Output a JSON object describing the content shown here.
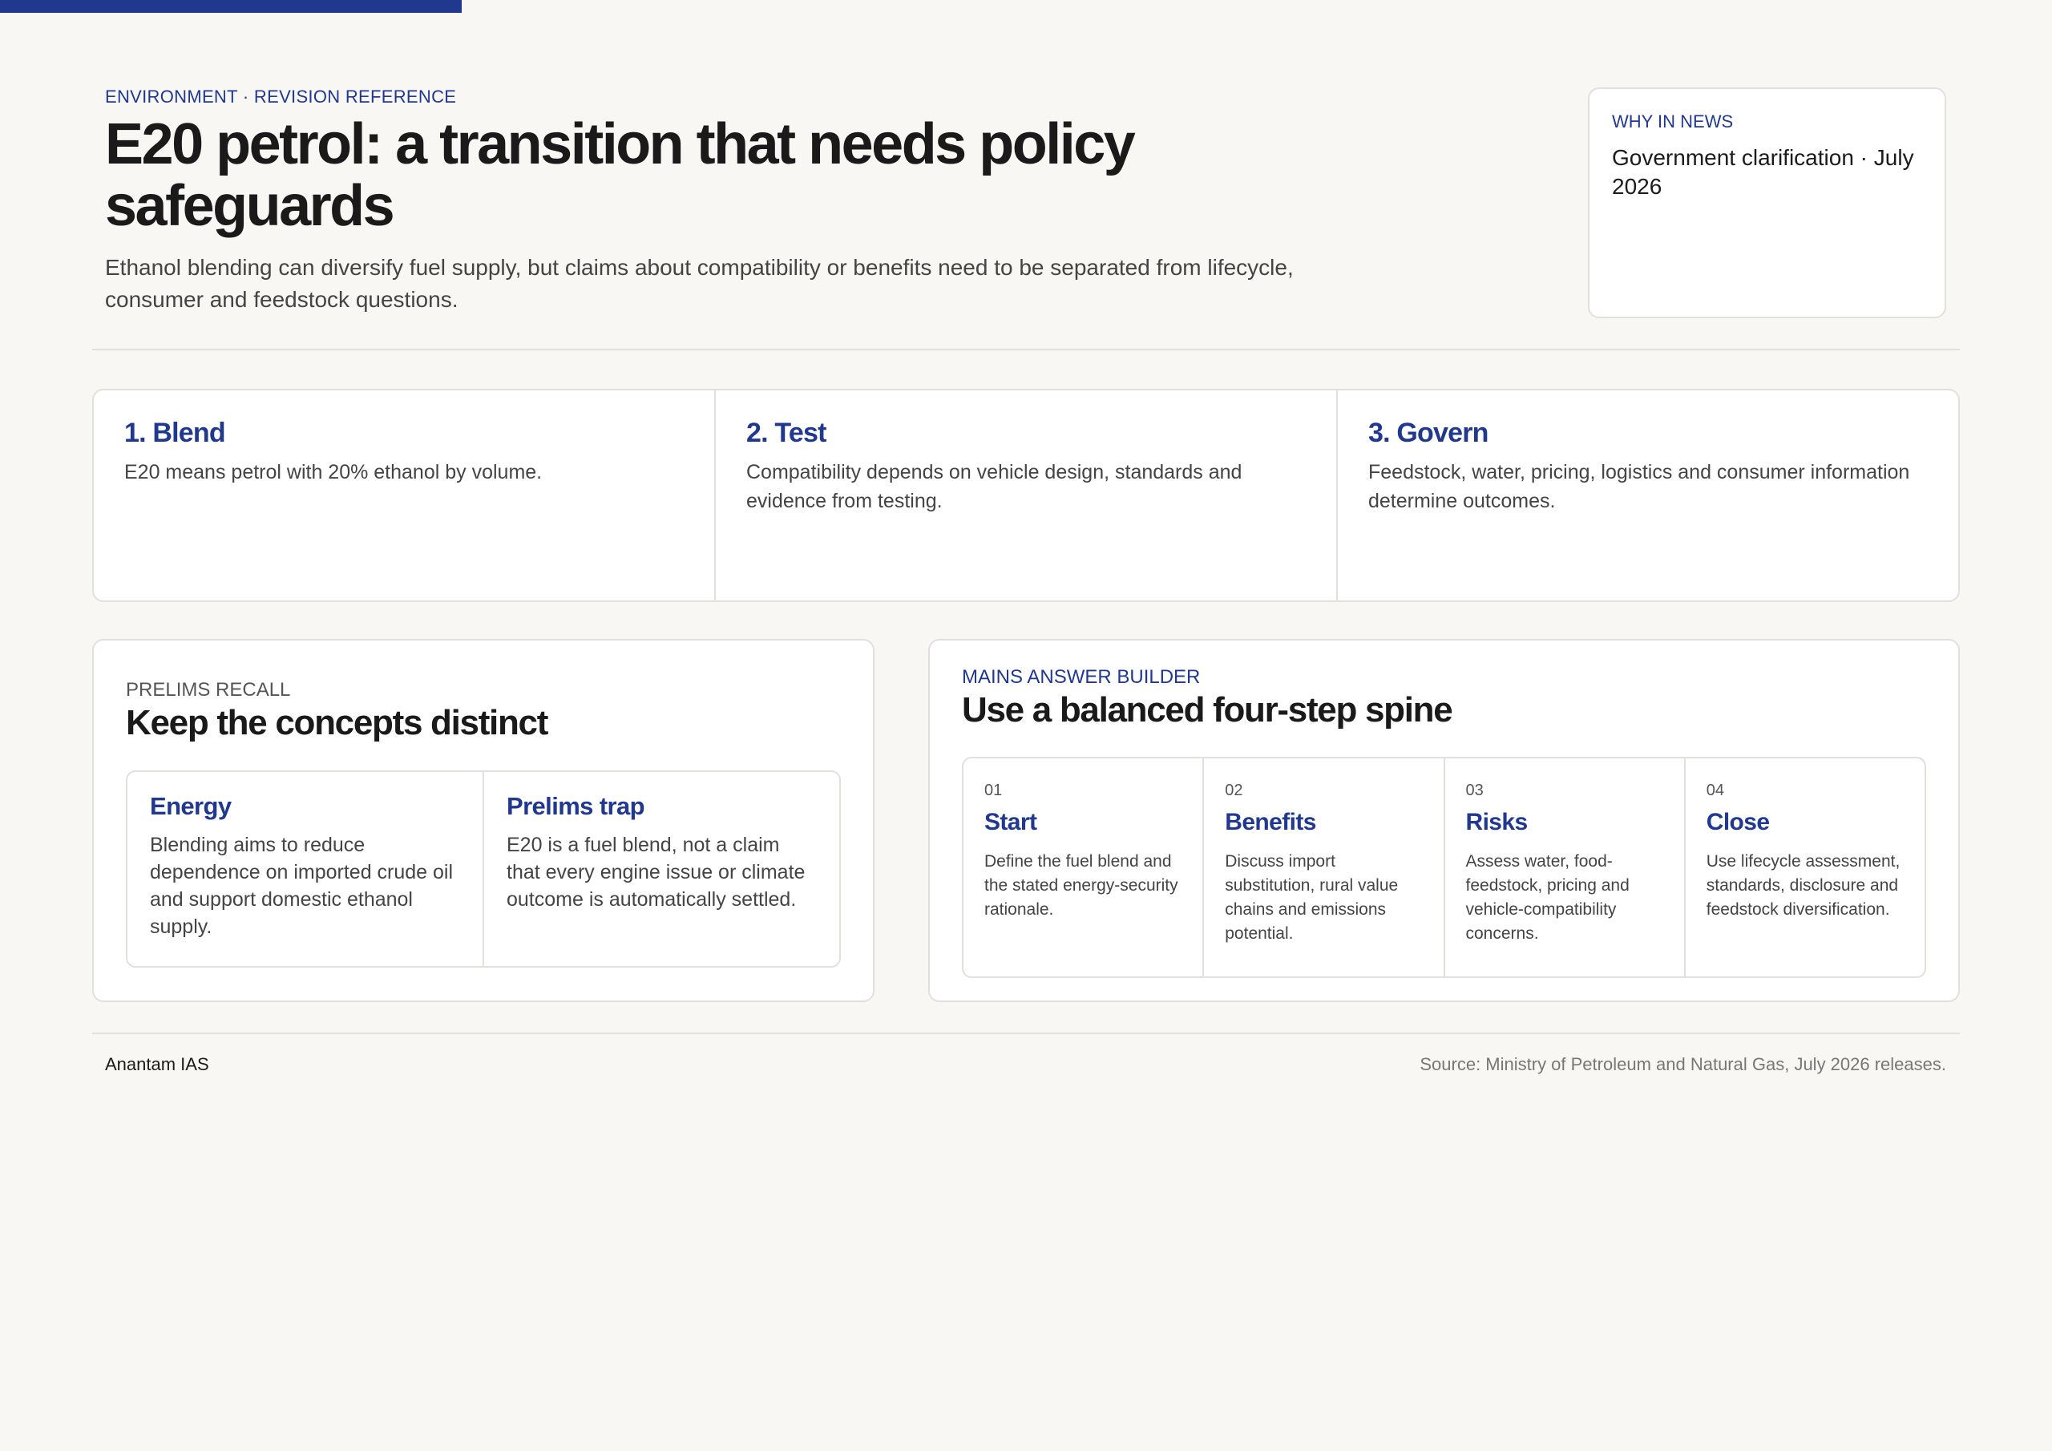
{
  "colors": {
    "accent": "#21388f",
    "background": "#f8f7f3",
    "card": "#ffffff",
    "border": "#e2e0da"
  },
  "header": {
    "eyebrow": "ENVIRONMENT · REVISION REFERENCE",
    "title": "E20 petrol: a transition that needs policy safeguards",
    "subtitle": "Ethanol blending can diversify fuel supply, but claims about compatibility or benefits need to be separated from lifecycle, consumer and feedstock questions."
  },
  "news": {
    "label": "WHY IN NEWS",
    "text": "Government clarification · July 2026"
  },
  "steps": [
    {
      "title": "1. Blend",
      "text": "E20 means petrol with 20% ethanol by volume."
    },
    {
      "title": "2. Test",
      "text": "Compatibility depends on vehicle design, standards and evidence from testing."
    },
    {
      "title": "3. Govern",
      "text": "Feedstock, water, pricing, logistics and consumer information determine outcomes."
    }
  ],
  "prelims": {
    "eyebrow": "PRELIMS RECALL",
    "title": "Keep the concepts distinct",
    "concepts": [
      {
        "title": "Energy",
        "text": "Blending aims to reduce dependence on imported crude oil and support domestic ethanol supply."
      },
      {
        "title": "Prelims trap",
        "text": "E20 is a fuel blend, not a claim that every engine issue or climate outcome is automatically settled."
      }
    ]
  },
  "mains": {
    "eyebrow": "MAINS ANSWER BUILDER",
    "title": "Use a balanced four-step spine",
    "steps": [
      {
        "num": "01",
        "title": "Start",
        "text": "Define the fuel blend and the stated energy-security rationale."
      },
      {
        "num": "02",
        "title": "Benefits",
        "text": "Discuss import substitution, rural value chains and emissions potential."
      },
      {
        "num": "03",
        "title": "Risks",
        "text": "Assess water, food-feedstock, pricing and vehicle-compatibility concerns."
      },
      {
        "num": "04",
        "title": "Close",
        "text": "Use lifecycle assessment, standards, disclosure and feedstock diversification."
      }
    ]
  },
  "footer": {
    "brand": "Anantam IAS",
    "source": "Source: Ministry of Petroleum and Natural Gas, July 2026 releases."
  }
}
